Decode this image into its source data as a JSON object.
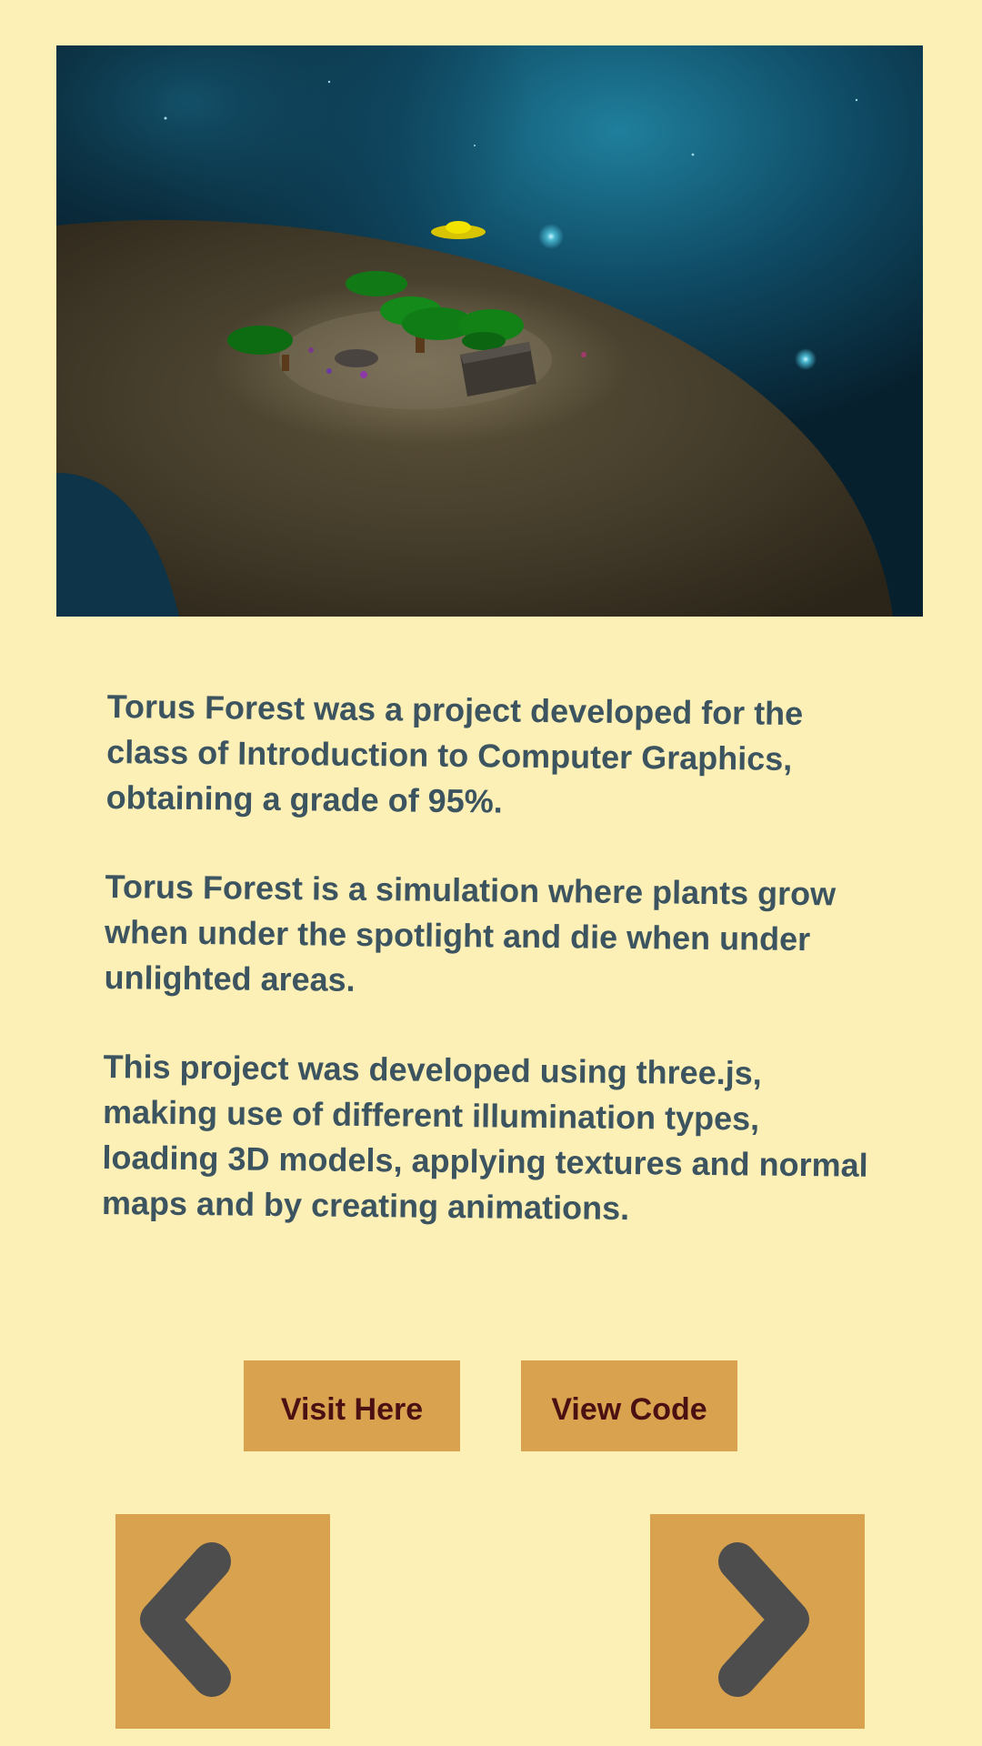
{
  "hero": {
    "image_name": "torus-forest-screenshot"
  },
  "description": {
    "paragraph_1": "Torus Forest was a project developed for the class of Introduction to Computer Graphics, obtaining a grade of 95%.",
    "paragraph_2": "Torus Forest is a simulation where plants grow when under the spotlight and die when under unlighted areas.",
    "paragraph_3": "This project was developed using three.js, making use of different illumination types, loading 3D models, applying textures and normal maps and by creating animations."
  },
  "buttons": {
    "visit_label": "Visit Here",
    "code_label": "View Code"
  },
  "navigation": {
    "prev_icon": "chevron-left-icon",
    "next_icon": "chevron-right-icon"
  },
  "colors": {
    "background": "#fdf0b6",
    "button": "#d9a24f",
    "button_text": "#4b1112",
    "body_text": "#3c5360",
    "chevron": "#4d4d4d"
  }
}
